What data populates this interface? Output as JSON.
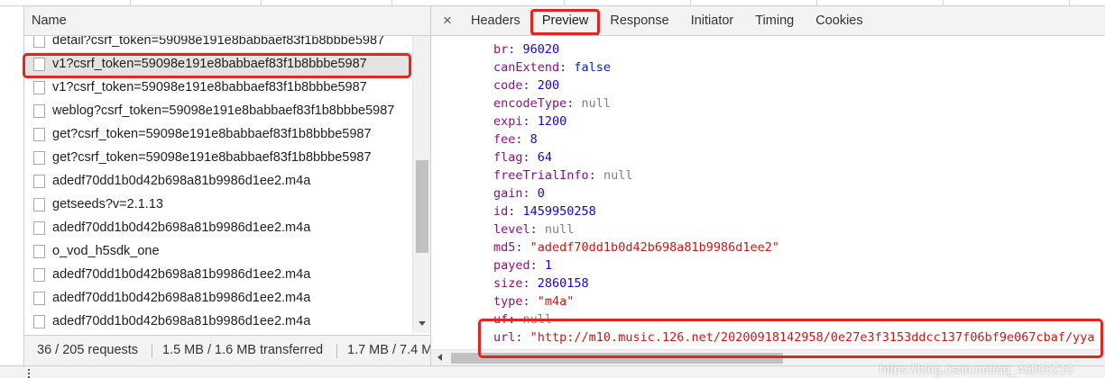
{
  "request_list": {
    "header": {
      "name_label": "Name"
    },
    "rows": [
      {
        "name": "detail?csrf_token=59098e191e8babbaef83f1b8bbbe5987",
        "icon": "file-icon"
      },
      {
        "name": "v1?csrf_token=59098e191e8babbaef83f1b8bbbe5987",
        "icon": "file-icon",
        "selected": true
      },
      {
        "name": "v1?csrf_token=59098e191e8babbaef83f1b8bbbe5987",
        "icon": "file-icon"
      },
      {
        "name": "weblog?csrf_token=59098e191e8babbaef83f1b8bbbe5987",
        "icon": "file-icon"
      },
      {
        "name": "get?csrf_token=59098e191e8babbaef83f1b8bbbe5987",
        "icon": "file-icon"
      },
      {
        "name": "get?csrf_token=59098e191e8babbaef83f1b8bbbe5987",
        "icon": "file-icon"
      },
      {
        "name": "adedf70dd1b0d42b698a81b9986d1ee2.m4a",
        "icon": "file-icon"
      },
      {
        "name": "getseeds?v=2.1.13",
        "icon": "file-icon"
      },
      {
        "name": "adedf70dd1b0d42b698a81b9986d1ee2.m4a",
        "icon": "file-icon"
      },
      {
        "name": "o_vod_h5sdk_one",
        "icon": "file-icon"
      },
      {
        "name": "adedf70dd1b0d42b698a81b9986d1ee2.m4a",
        "icon": "file-icon"
      },
      {
        "name": "adedf70dd1b0d42b698a81b9986d1ee2.m4a",
        "icon": "file-icon"
      },
      {
        "name": "adedf70dd1b0d42b698a81b9986d1ee2.m4a",
        "icon": "file-icon"
      }
    ]
  },
  "status_bar": {
    "requests": "36 / 205 requests",
    "transferred": "1.5 MB / 1.6 MB transferred",
    "resources": "1.7 MB / 7.4 M"
  },
  "detail_tabs": {
    "close_label": "×",
    "tabs": [
      {
        "label": "Headers"
      },
      {
        "label": "Preview",
        "active": true
      },
      {
        "label": "Response"
      },
      {
        "label": "Initiator"
      },
      {
        "label": "Timing"
      },
      {
        "label": "Cookies"
      }
    ]
  },
  "preview": {
    "lines": [
      {
        "key": "br",
        "value": "96020",
        "type": "number"
      },
      {
        "key": "canExtend",
        "value": "false",
        "type": "boolean"
      },
      {
        "key": "code",
        "value": "200",
        "type": "number"
      },
      {
        "key": "encodeType",
        "value": "null",
        "type": "null"
      },
      {
        "key": "expi",
        "value": "1200",
        "type": "number"
      },
      {
        "key": "fee",
        "value": "8",
        "type": "number"
      },
      {
        "key": "flag",
        "value": "64",
        "type": "number"
      },
      {
        "key": "freeTrialInfo",
        "value": "null",
        "type": "null"
      },
      {
        "key": "gain",
        "value": "0",
        "type": "number"
      },
      {
        "key": "id",
        "value": "1459950258",
        "type": "number"
      },
      {
        "key": "level",
        "value": "null",
        "type": "null"
      },
      {
        "key": "md5",
        "value": "\"adedf70dd1b0d42b698a81b9986d1ee2\"",
        "type": "string"
      },
      {
        "key": "payed",
        "value": "1",
        "type": "number"
      },
      {
        "key": "size",
        "value": "2860158",
        "type": "number"
      },
      {
        "key": "type",
        "value": "\"m4a\"",
        "type": "string"
      },
      {
        "key": "uf",
        "value": "null",
        "type": "null"
      },
      {
        "key": "url",
        "value": "\"http://m10.music.126.net/20200918142958/0e27e3f3153ddcc137f06bf9e067cbaf/yya",
        "type": "string"
      }
    ]
  },
  "watermark": {
    "text": "https://blog.csdn.net/qq_45006210"
  },
  "colors": {
    "selected_row": "#e3e3e3",
    "property_key": "#881280",
    "active_tab_underline": "#1a73e8",
    "annotation": "#e3251f",
    "value_types": {
      "number": "#1c00cf",
      "boolean": "#0d22aa",
      "null": "#808080",
      "string": "#c41a16"
    }
  }
}
